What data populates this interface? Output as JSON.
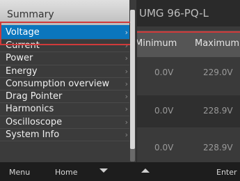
{
  "device": {
    "title": "UMG 96-PQ-L",
    "columns": {
      "minimum": "Minimum",
      "maximum": "Maximum"
    },
    "rows": [
      {
        "min": "0.0V",
        "max": "229.0V"
      },
      {
        "min": "0.0V",
        "max": "228.9V"
      },
      {
        "min": "0.0V",
        "max": "228.9V"
      }
    ]
  },
  "menu": {
    "header": "Summary",
    "items": [
      {
        "label": "Voltage"
      },
      {
        "label": "Current"
      },
      {
        "label": "Power"
      },
      {
        "label": "Energy"
      },
      {
        "label": "Consumption overview"
      },
      {
        "label": "Drag Pointer"
      },
      {
        "label": "Harmonics"
      },
      {
        "label": "Oscilloscope"
      },
      {
        "label": "System Info"
      }
    ],
    "selected": "Voltage",
    "chevron": "›"
  },
  "softkeys": {
    "menu": "Menu",
    "home": "Home",
    "down_icon": "arrow-down",
    "up_icon": "arrow-up",
    "enter": "Enter"
  },
  "colors": {
    "selection": "#0b76bd",
    "highlight": "#d03a3a"
  }
}
